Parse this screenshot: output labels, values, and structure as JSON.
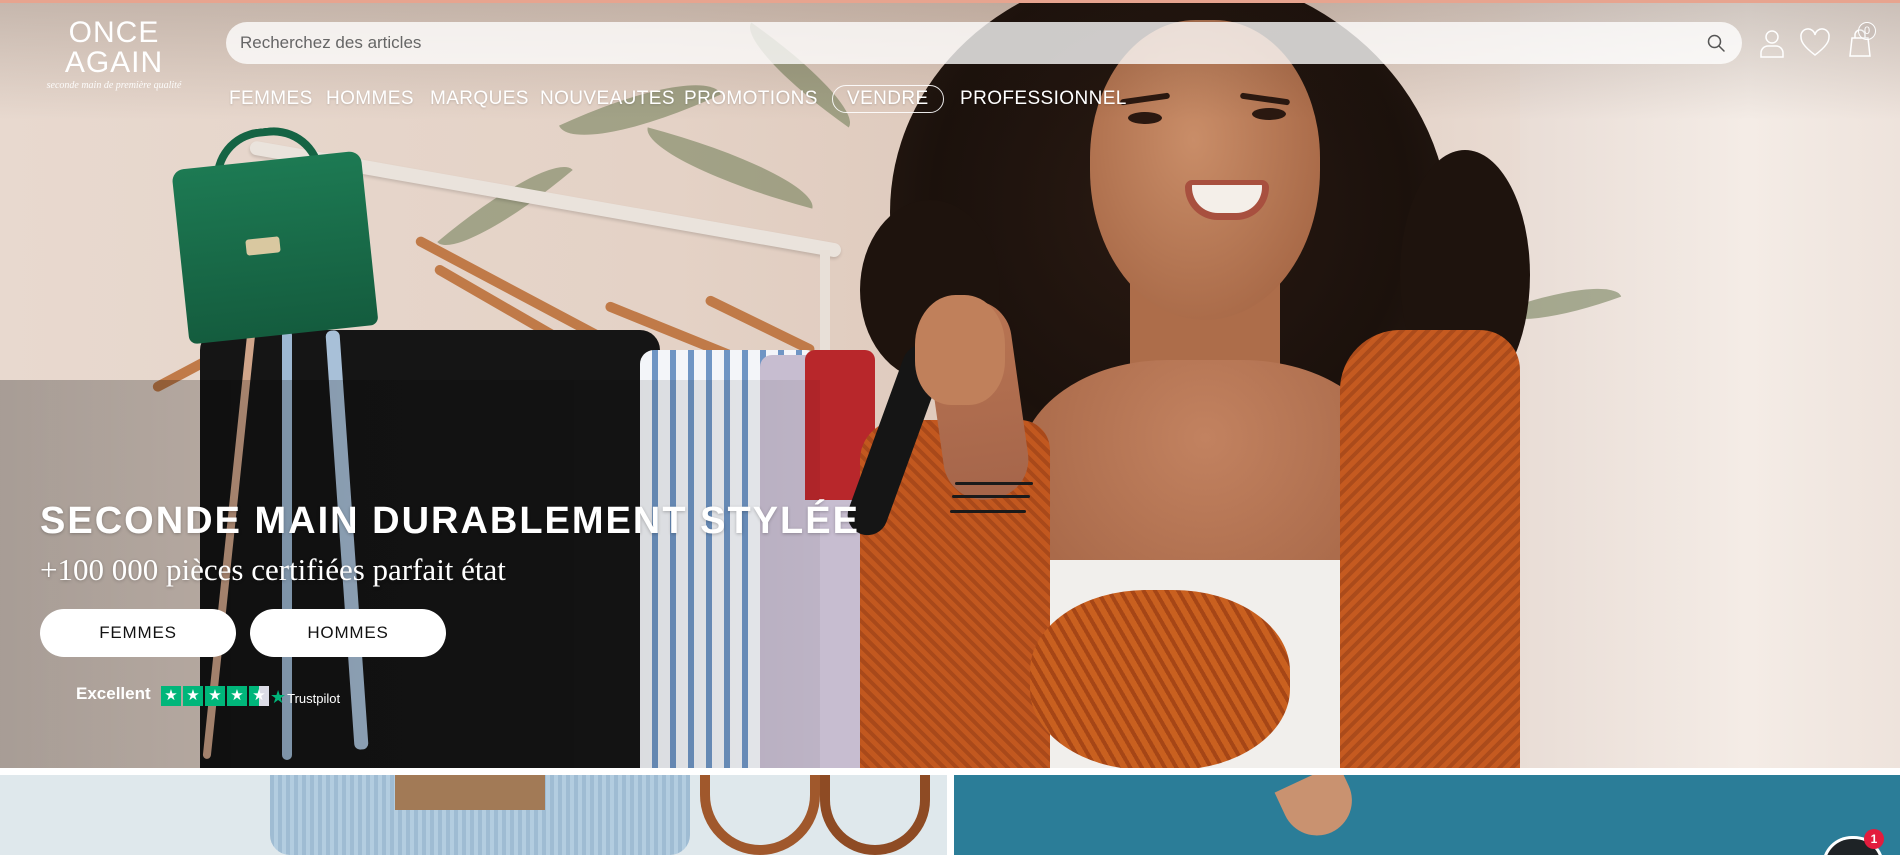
{
  "brand": {
    "name": "ONCE AGAIN",
    "tagline": "seconde main de première qualité"
  },
  "search": {
    "placeholder": "Recherchez des articles"
  },
  "header_icons": {
    "account": "user-icon",
    "wishlist": "heart-icon",
    "cart": "bag-icon",
    "cart_count": "0"
  },
  "nav": {
    "items": [
      {
        "label": "FEMMES"
      },
      {
        "label": "HOMMES"
      },
      {
        "label": "MARQUES"
      },
      {
        "label": "NOUVEAUTES"
      },
      {
        "label": "PROMOTIONS"
      },
      {
        "label": "VENDRE"
      },
      {
        "label": "PROFESSIONNEL"
      }
    ]
  },
  "hero": {
    "title": "SECONDE MAIN DURABLEMENT STYLÉE",
    "subtitle": "+100 000 pièces certifiées parfait état",
    "cta_women": "FEMMES",
    "cta_men": "HOMMES"
  },
  "trustpilot": {
    "rating_label": "Excellent",
    "brand": "Trustpilot",
    "stars": 4.5
  },
  "chat": {
    "unread": "1"
  },
  "colors": {
    "accent_line": "#e7a48f",
    "trustpilot_green": "#00b67a",
    "chat_badge": "#e31c3d"
  }
}
